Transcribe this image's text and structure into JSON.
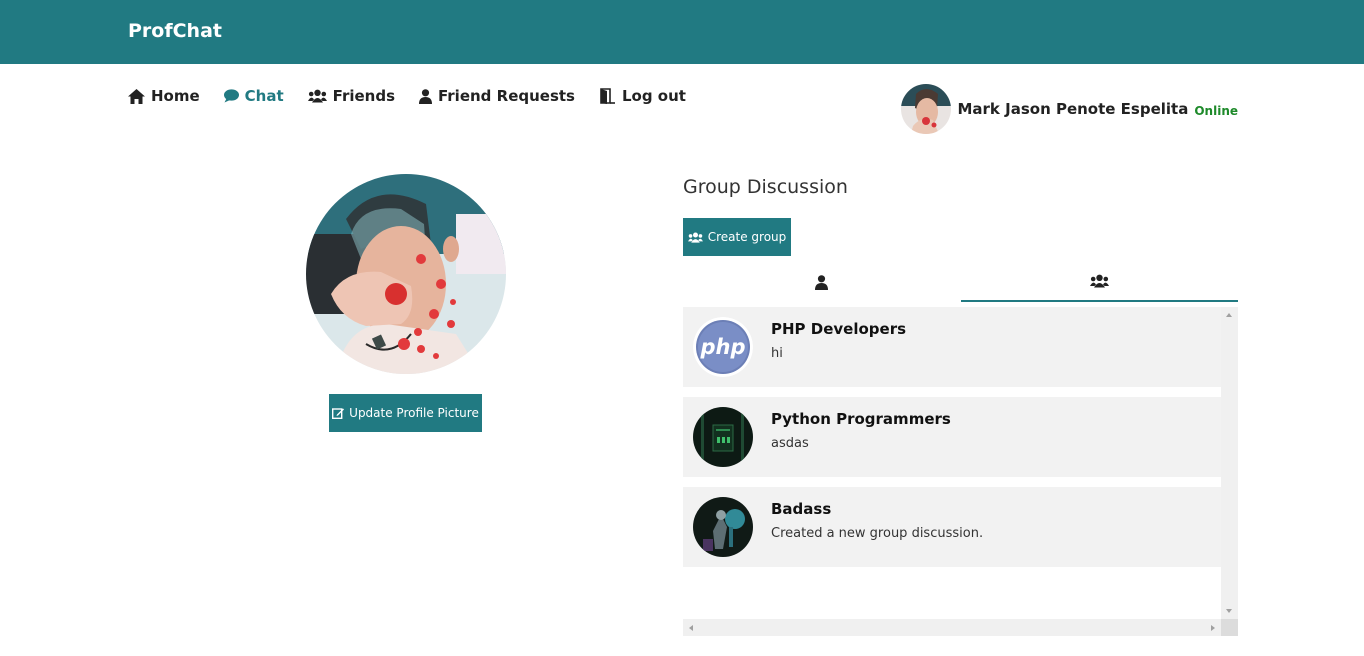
{
  "app": {
    "brand": "ProfChat",
    "accent_color": "#217a82",
    "online_color": "#1e8a2a"
  },
  "nav": {
    "items": [
      {
        "label": "Home",
        "icon": "home-icon",
        "active": false
      },
      {
        "label": "Chat",
        "icon": "comment-icon",
        "active": true
      },
      {
        "label": "Friends",
        "icon": "users-icon",
        "active": false
      },
      {
        "label": "Friend Requests",
        "icon": "user-icon",
        "active": false
      },
      {
        "label": "Log out",
        "icon": "door-open-icon",
        "active": false
      }
    ]
  },
  "user": {
    "name": "Mark Jason Penote Espelita",
    "status": "Online"
  },
  "profile": {
    "update_button": "Update Profile Picture",
    "update_icon": "edit-icon"
  },
  "group_discussion": {
    "title": "Group Discussion",
    "create_button": "Create group",
    "create_icon": "users-icon",
    "tabs": [
      {
        "icon": "user-icon",
        "active": false
      },
      {
        "icon": "users-icon",
        "active": true
      }
    ],
    "groups": [
      {
        "name": "PHP Developers",
        "last_message": "hi",
        "avatar": "php-logo"
      },
      {
        "name": "Python Programmers",
        "last_message": "asdas",
        "avatar": "code-screen-image"
      },
      {
        "name": "Badass",
        "last_message": "Created a new group discussion.",
        "avatar": "character-image"
      }
    ]
  }
}
